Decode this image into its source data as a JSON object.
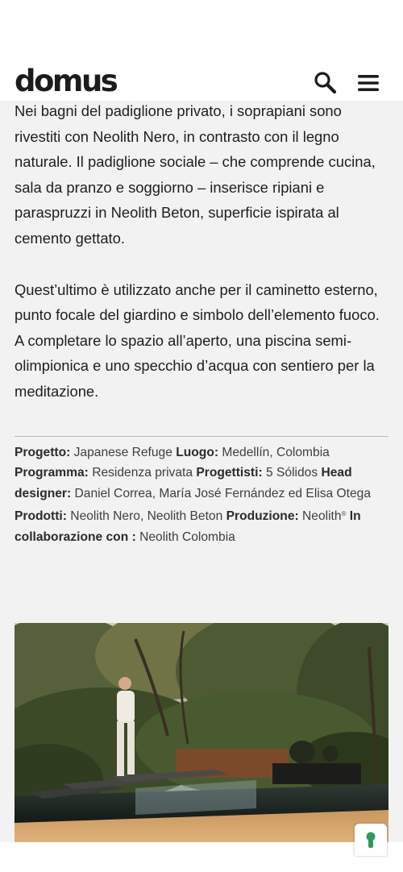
{
  "header": {
    "logo": "domus",
    "search_icon": "search-icon",
    "menu_icon": "hamburger-menu-icon"
  },
  "article": {
    "paragraphs": [
      "Nei bagni del padiglione privato, i soprapiani sono rivestiti con Neolith Nero, in contrasto con il legno naturale. Il padiglione sociale – che comprende cucina, sala da pranzo e soggiorno – inserisce ripiani e paraspruzzi in Neolith Beton, superficie ispirata al cemento gettato.",
      "Quest’ultimo è utilizzato anche per il caminetto esterno, punto focale del giardino e simbolo dell’elemento fuoco. A completare lo spazio all’aperto, una piscina semi-olimpionica e uno specchio d’acqua con sentiero per la meditazione."
    ]
  },
  "credits": {
    "progetto_label": "Progetto:",
    "progetto_value": " Japanese Refuge ",
    "luogo_label": "Luogo:",
    "luogo_value": " Medellín, Colombia ",
    "programma_label": "Programma:",
    "programma_value": " Residenza privata ",
    "progettisti_label": "Progettisti:",
    "progettisti_value": " 5 Sólidos ",
    "head_label": "Head designer:",
    "head_value": " Daniel Correa, María José Fernández ed Elisa Otega ",
    "prodotti_label": "Prodotti:",
    "prodotti_value": " Neolith Nero, Neolith Beton ",
    "produzione_label": "Produzione:",
    "produzione_value": " Neolith",
    "produzione_mark": "®",
    "collab_label": " In collaborazione con :",
    "collab_value": " Neolith Colombia"
  },
  "image": {
    "icon": "photo-pool-garden-icon"
  },
  "floating_button": {
    "icon": "keyhole-icon",
    "color": "#2e9a5e"
  },
  "colors": {
    "background": "#f2f2f2",
    "header_bg": "#ffffff",
    "text": "#1e1e1e",
    "accent_green": "#2e9a5e"
  }
}
